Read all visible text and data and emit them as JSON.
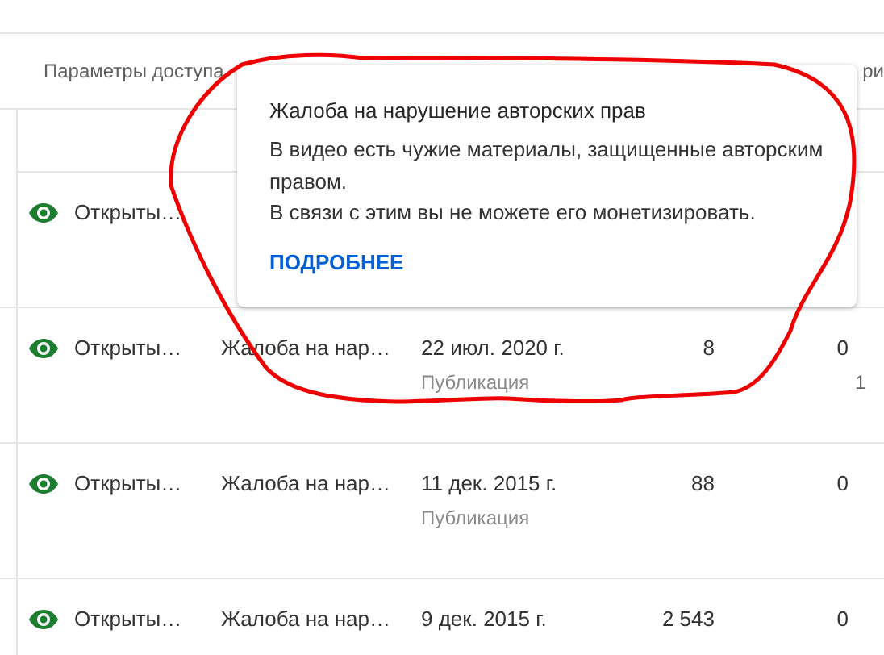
{
  "table": {
    "columns": [
      {
        "label": "Параметры доступа"
      },
      {
        "label": "ри"
      }
    ],
    "rows": [
      {
        "visibility": "Открыты…"
      },
      {
        "visibility": "Открыты…",
        "restriction": "Жалоба на нар…",
        "date": "22 июл. 2020 г.",
        "date_type": "Публикация",
        "views": "8",
        "comments": "0",
        "column_7": "1"
      },
      {
        "visibility": "Открыты…",
        "restriction": "Жалоба на нар…",
        "date": "11 дек. 2015 г.",
        "date_type": "Публикация",
        "views": "88",
        "comments": "0"
      },
      {
        "visibility": "Открыты…",
        "restriction": "Жалоба на нар…",
        "date": "9 дек. 2015 г.",
        "views": "2 543",
        "comments": "0"
      }
    ]
  },
  "tooltip": {
    "title": "Жалоба на нарушение авторских прав",
    "lines": [
      "В видео есть чужие материалы, защищенные авторским правом.",
      "В связи с этим вы не можете его монетизировать."
    ],
    "link": "ПОДРОБНЕЕ"
  }
}
